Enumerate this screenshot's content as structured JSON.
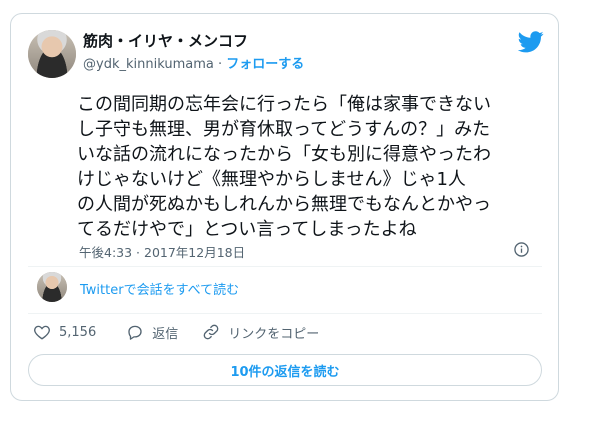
{
  "tweet": {
    "author_name": "筋肉・イリヤ・メンコフ",
    "handle": "@ydk_kinnikumama",
    "separator": " · ",
    "follow_label": "フォローする",
    "text": "この間同期の忘年会に行ったら「俺は家事できない\nし子守も無理、男が育休取ってどうすんの？」みた\nいな話の流れになったから「女も別に得意やったわ\nけじゃないけど《無理やからしません》じゃ1人\nの人間が死ぬかもしれんから無理でもなんとかやっ\nてるだけやで」とつい言ってしまったよね",
    "timestamp": "午後4:33 · 2017年12月18日"
  },
  "conversation": {
    "link_label": "Twitterで会話をすべて読む"
  },
  "actions": {
    "like_count": "5,156",
    "reply_label": "返信",
    "copy_link_label": "リンクをコピー"
  },
  "read_replies_label": "10件の返信を読む",
  "colors": {
    "accent": "#1d9bf0",
    "secondary_text": "#536471",
    "border": "#cfd9de"
  },
  "icons": [
    "twitter-bird-icon",
    "info-icon",
    "heart-icon",
    "reply-icon",
    "link-icon"
  ]
}
